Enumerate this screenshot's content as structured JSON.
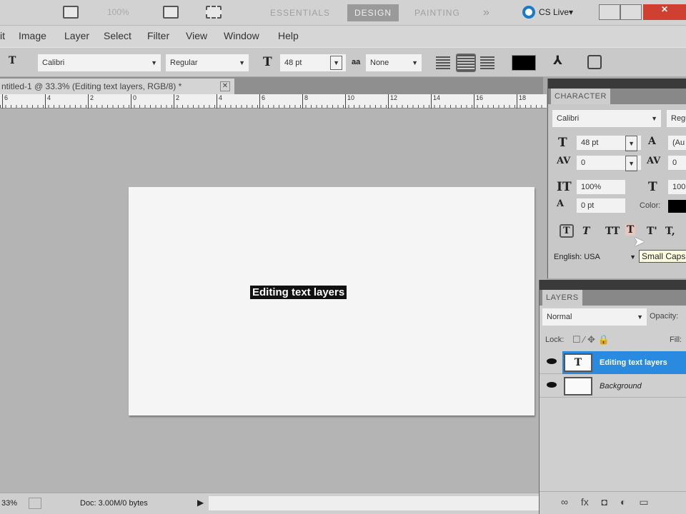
{
  "appbar": {
    "zoom": "100%",
    "workspaces": [
      "ESSENTIALS",
      "DESIGN",
      "PAINTING"
    ],
    "active_workspace": "DESIGN",
    "more": "»",
    "cs_live": "CS Live▾"
  },
  "menu": [
    "it",
    "Image",
    "Layer",
    "Select",
    "Filter",
    "View",
    "Window",
    "Help"
  ],
  "options": {
    "font": "Calibri",
    "style": "Regular",
    "size": "48 pt",
    "antialias": "None"
  },
  "document": {
    "tab_title": "ntitled-1 @ 33.3% (Editing text layers, RGB/8) *",
    "text": "Editing text layers"
  },
  "ruler": [
    "6",
    "4",
    "2",
    "0",
    "2",
    "4",
    "6",
    "8",
    "10",
    "12",
    "14",
    "16",
    "18"
  ],
  "status": {
    "zoom": "33%",
    "doc": "Doc: 3.00M/0 bytes"
  },
  "character": {
    "title": "CHARACTER",
    "font": "Calibri",
    "style": "Regu",
    "size": "48 pt",
    "leading": "(Au",
    "kerning": "0",
    "tracking": "0",
    "vscale": "100%",
    "hscale": "100",
    "baseline": "0 pt",
    "color_label": "Color:",
    "language": "English: USA",
    "tooltip": "Small Caps"
  },
  "layers": {
    "title": "LAYERS",
    "blend": "Normal",
    "opacity_label": "Opacity:",
    "lock_label": "Lock:",
    "fill_label": "Fill:",
    "items": [
      {
        "name": "Editing text layers",
        "thumb": "T",
        "selected": true
      },
      {
        "name": "Background",
        "thumb": "",
        "selected": false
      }
    ]
  }
}
